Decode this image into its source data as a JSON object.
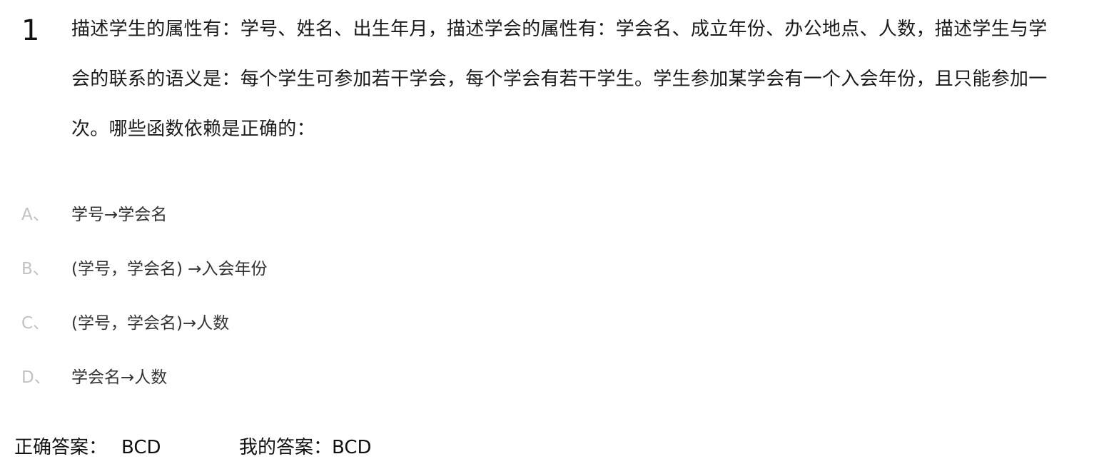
{
  "question": {
    "number": "1",
    "text": "描述学生的属性有：学号、姓名、出生年月，描述学会的属性有：学会名、成立年份、办公地点、人数，描述学生与学会的联系的语义是：每个学生可参加若干学会，每个学会有若干学生。学生参加某学会有一个入会年份，且只能参加一次。哪些函数依赖是正确的："
  },
  "options": [
    {
      "letter": "A、",
      "text": "学号→学会名"
    },
    {
      "letter": "B、",
      "text": "(学号，学会名) →入会年份"
    },
    {
      "letter": "C、",
      "text": "(学号，学会名)→人数"
    },
    {
      "letter": "D、",
      "text": "学会名→人数"
    }
  ],
  "answers": {
    "correct_label": "正确答案：",
    "correct_value": "BCD",
    "mine_label": "我的答案：",
    "mine_value": "BCD"
  }
}
